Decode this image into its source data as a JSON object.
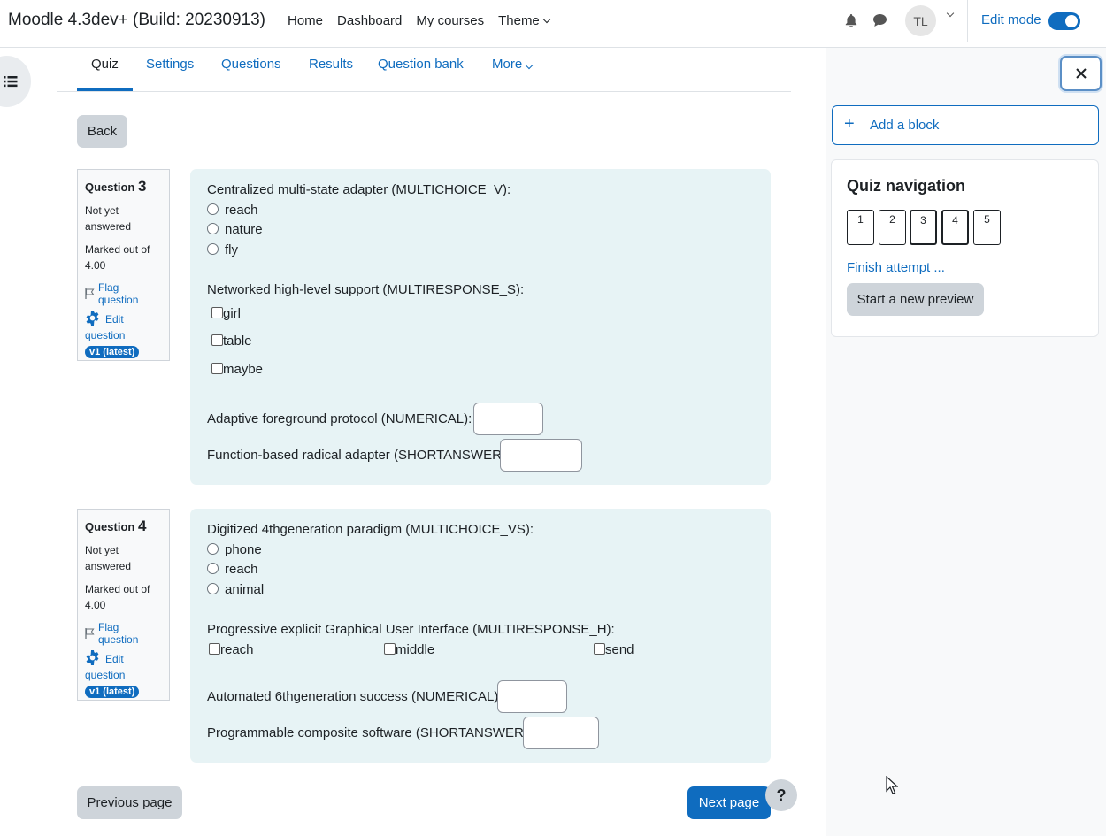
{
  "navbar": {
    "brand": "Moodle 4.3dev+ (Build: 20230913)",
    "links": [
      "Home",
      "Dashboard",
      "My courses",
      "Theme"
    ],
    "avatar_initials": "TL",
    "edit_mode_label": "Edit mode"
  },
  "secondary_nav": {
    "tabs": [
      "Quiz",
      "Settings",
      "Questions",
      "Results",
      "Question bank",
      "More"
    ],
    "active": "Quiz"
  },
  "back_label": "Back",
  "questions": [
    {
      "label": "Question",
      "number": "3",
      "state": "Not yet answered",
      "grade": "Marked out of 4.00",
      "flag_label": "Flag question",
      "edit_label": "Edit question",
      "version": "v1 (latest)",
      "mc_prompt": "Centralized multi-state adapter (MULTICHOICE_V):",
      "mc_options": [
        "reach",
        "nature",
        "fly"
      ],
      "mr_prompt": "Networked high-level support (MULTIRESPONSE_S):",
      "mr_options": [
        "girl",
        "table",
        "maybe"
      ],
      "num_prompt": "Adaptive foreground protocol (NUMERICAL):",
      "sa_prompt": "Function-based radical adapter (SHORTANSWER):"
    },
    {
      "label": "Question",
      "number": "4",
      "state": "Not yet answered",
      "grade": "Marked out of 4.00",
      "flag_label": "Flag question",
      "edit_label": "Edit question",
      "version": "v1 (latest)",
      "mc_prompt": "Digitized 4thgeneration paradigm (MULTICHOICE_VS):",
      "mc_options": [
        "phone",
        "reach",
        "animal"
      ],
      "mr_prompt": "Progressive explicit Graphical User Interface (MULTIRESPONSE_H):",
      "mr_options": [
        "reach",
        "middle",
        "send"
      ],
      "num_prompt": "Automated 6thgeneration success (NUMERICAL):",
      "sa_prompt": "Programmable composite software (SHORTANSWER):"
    }
  ],
  "prev_label": "Previous page",
  "next_label": "Next page",
  "help_label": "?",
  "drawer": {
    "close_label": "×",
    "add_block_label": "Add a block",
    "quiz_nav_title": "Quiz navigation",
    "question_buttons": [
      "1",
      "2",
      "3",
      "4",
      "5"
    ],
    "finish_label": "Finish attempt ...",
    "new_preview_label": "Start a new preview"
  }
}
